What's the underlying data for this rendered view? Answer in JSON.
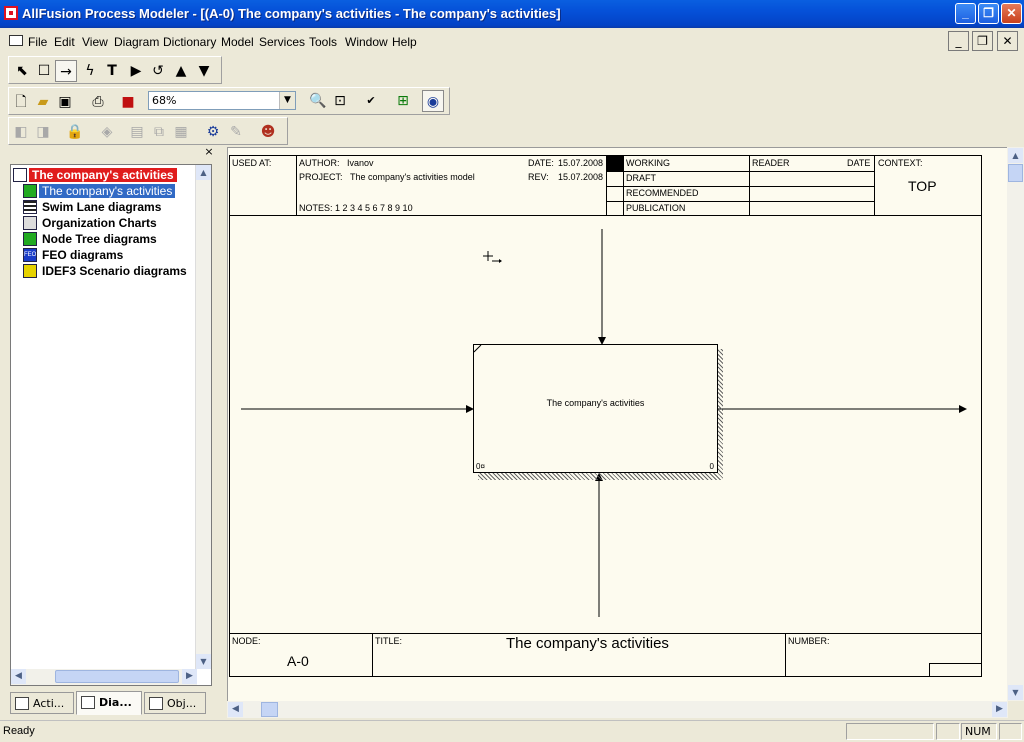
{
  "window": {
    "title": "AllFusion Process Modeler - [(A-0) The company's activities - The company's activities]",
    "minimize_label": "_",
    "maximize_label": "❐",
    "close_label": "✕"
  },
  "menu": {
    "items": [
      "File",
      "Edit",
      "View",
      "Diagram",
      "Dictionary",
      "Model",
      "Services",
      "Tools",
      "Window",
      "Help"
    ],
    "mdi_minimize": "_",
    "mdi_restore": "❐",
    "mdi_close": "✕"
  },
  "toolbar": {
    "zoom_value": "68%",
    "drawing_tools": [
      "pointer-icon",
      "box-tool-icon",
      "arrow-tool-icon",
      "squiggle-tool-icon",
      "text-tool-icon",
      "off-page-reference-icon",
      "undo-icon",
      "go-to-parent-icon",
      "go-to-child-icon"
    ]
  },
  "model_explorer": {
    "close_label": "×",
    "root_label": "The company's activities",
    "items": [
      {
        "label": "The company's activities",
        "icon": "diagram-icon",
        "color": "#22aa22",
        "selected": true
      },
      {
        "label": "Swim Lane diagrams",
        "icon": "swim-lane-icon",
        "color": "#222222",
        "selected": false
      },
      {
        "label": "Organization Charts",
        "icon": "org-chart-icon",
        "color": "#555555",
        "selected": false
      },
      {
        "label": "Node Tree diagrams",
        "icon": "node-tree-icon",
        "color": "#22aa22",
        "selected": false
      },
      {
        "label": "FEO diagrams",
        "icon": "feo-icon",
        "color": "#1a3cc8",
        "selected": false
      },
      {
        "label": "IDEF3 Scenario diagrams",
        "icon": "idef3-icon",
        "color": "#e6d200",
        "selected": false
      }
    ],
    "feo_icon_text": "FEO",
    "tabs": [
      "Acti...",
      "Dia...",
      "Obj..."
    ],
    "active_tab": 1
  },
  "diagram": {
    "header": {
      "used_at_label": "USED AT:",
      "author_label": "AUTHOR:",
      "author": "Ivanov",
      "project_label": "PROJECT:",
      "project": "The company's activities model",
      "date_label": "DATE:",
      "date": "15.07.2008",
      "rev_label": "REV:",
      "rev": "15.07.2008",
      "notes": "NOTES:  1  2  3  4  5  6  7  8  9  10",
      "statuses": [
        "WORKING",
        "DRAFT",
        "RECOMMENDED",
        "PUBLICATION"
      ],
      "reader_label": "READER",
      "reader_date_label": "DATE",
      "context_label": "CONTEXT:",
      "context_value": "TOP"
    },
    "activity_box": {
      "title": "The company's activities",
      "node_number": "0¤",
      "cost": "0"
    },
    "footer": {
      "node_label": "NODE:",
      "node_value": "A-0",
      "title_label": "TITLE:",
      "title_value": "The company's activities",
      "number_label": "NUMBER:"
    }
  },
  "statusbar": {
    "message": "Ready",
    "num": "NUM"
  }
}
